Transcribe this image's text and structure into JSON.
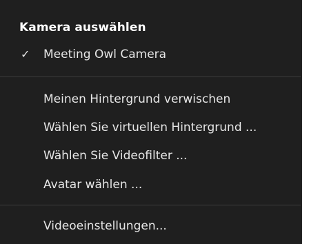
{
  "menu": {
    "section_title": "Kamera auswählen",
    "camera": {
      "label": "Meeting Owl Camera",
      "check_glyph": "✓",
      "checked": true
    },
    "options": [
      {
        "label": "Meinen Hintergrund verwischen"
      },
      {
        "label": "Wählen Sie virtuellen Hintergrund ..."
      },
      {
        "label": "Wählen Sie Videofilter ..."
      },
      {
        "label": "Avatar wählen ..."
      }
    ],
    "settings": {
      "label": "Videoeinstellungen..."
    }
  },
  "colors": {
    "background": "#1f1f1f",
    "text": "#e6e6e6",
    "title": "#ffffff",
    "divider": "#3c3c3c"
  }
}
